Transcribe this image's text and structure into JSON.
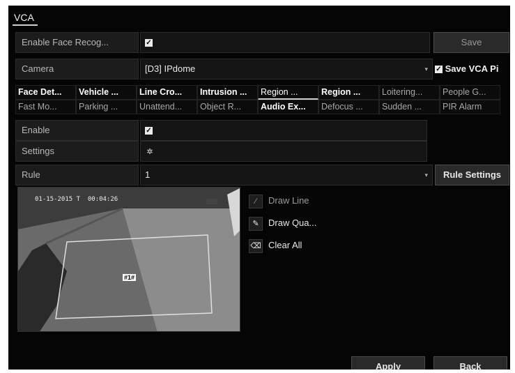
{
  "window": {
    "title": "VCA"
  },
  "face": {
    "label": "Enable Face Recog...",
    "checked": "✓"
  },
  "save_label": "Save",
  "camera": {
    "label": "Camera",
    "value": "[D3] IPdome",
    "save_pic_label": "Save VCA Pi"
  },
  "tabs": {
    "row1": [
      "Face Det...",
      "Vehicle ...",
      "Line Cro...",
      "Intrusion ...",
      "Region ...",
      "Region ...",
      "Loitering...",
      "People G..."
    ],
    "row2": [
      "Fast Mo...",
      "Parking ...",
      "Unattend...",
      "Object R...",
      "Audio Ex...",
      "Defocus ...",
      "Sudden ...",
      "PIR Alarm"
    ]
  },
  "enable": {
    "label": "Enable",
    "checked": "✓"
  },
  "settings": {
    "label": "Settings",
    "icon": "gear-icon"
  },
  "rule": {
    "label": "Rule",
    "value": "1",
    "settings_button": "Rule Settings"
  },
  "video": {
    "timestamp": "01-15-2015 T  00:04:26",
    "region_tag": "#1#"
  },
  "tools": {
    "draw_line": "Draw Line",
    "draw_quad": "Draw Qua...",
    "clear_all": "Clear All"
  },
  "footer": {
    "apply": "Apply",
    "back": "Back"
  },
  "colors": {
    "background": "#050505",
    "panel": "#1c1c1c",
    "text": "#e8e8e8"
  }
}
